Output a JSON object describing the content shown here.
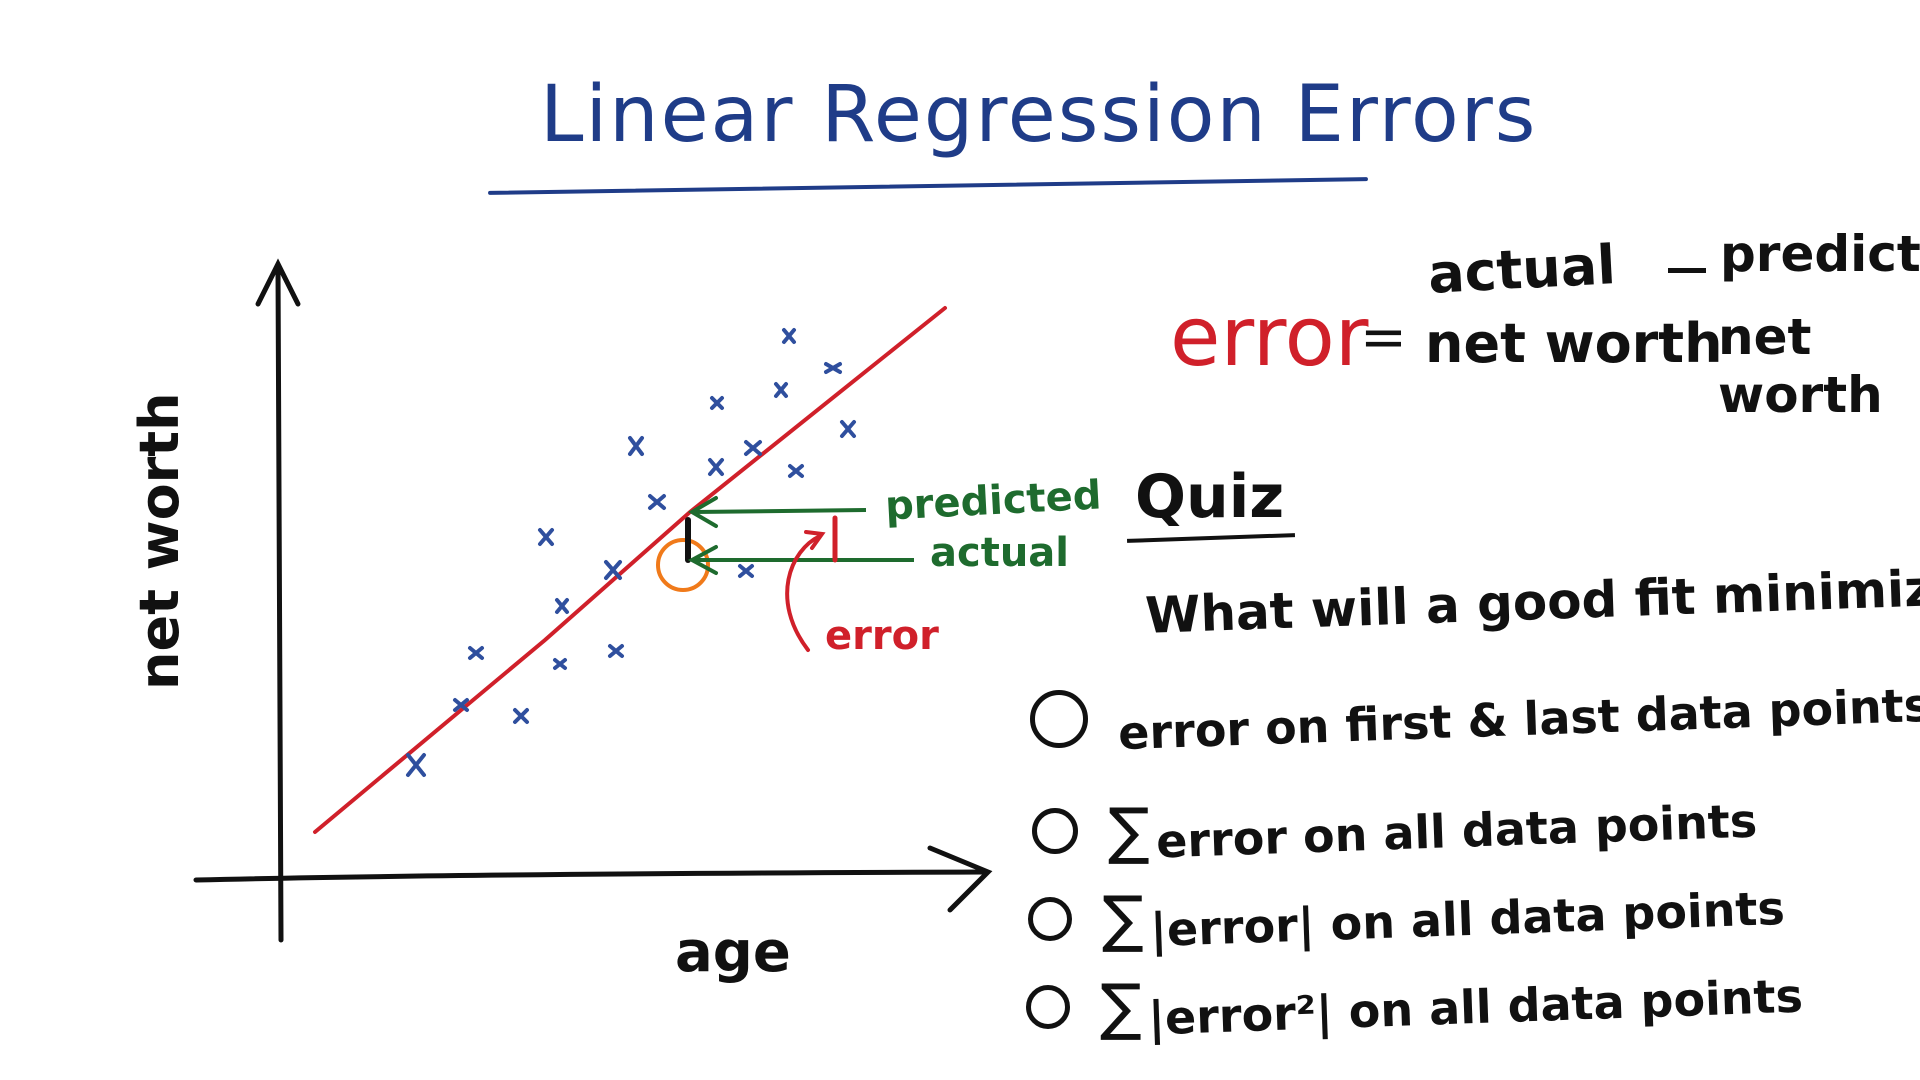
{
  "title": "Linear Regression Errors",
  "plot": {
    "y_axis_label": "net worth",
    "x_axis_label": "age",
    "annotation_predicted": "predicted",
    "annotation_actual": "actual",
    "annotation_error": "error",
    "colors": {
      "points": "#2f4f9e",
      "fit_line": "#d0202a",
      "arrows": "#1e6b2e",
      "highlight_circle": "#f07a1a",
      "axes": "#111111"
    }
  },
  "equation": {
    "lhs": "error",
    "equals": "=",
    "term1_line1": "actual",
    "term1_line2": "net worth",
    "term2_line1": "predicted",
    "term2_line2": "net worth"
  },
  "quiz": {
    "heading": "Quiz",
    "question": "What will a good fit minimize?",
    "options": [
      {
        "prefix": "",
        "text": "error on first & last data points"
      },
      {
        "prefix": "∑",
        "text": "error on all data points"
      },
      {
        "prefix": "∑",
        "text": "|error| on all data points"
      },
      {
        "prefix": "∑",
        "text": "|error²| on all data points"
      }
    ]
  }
}
